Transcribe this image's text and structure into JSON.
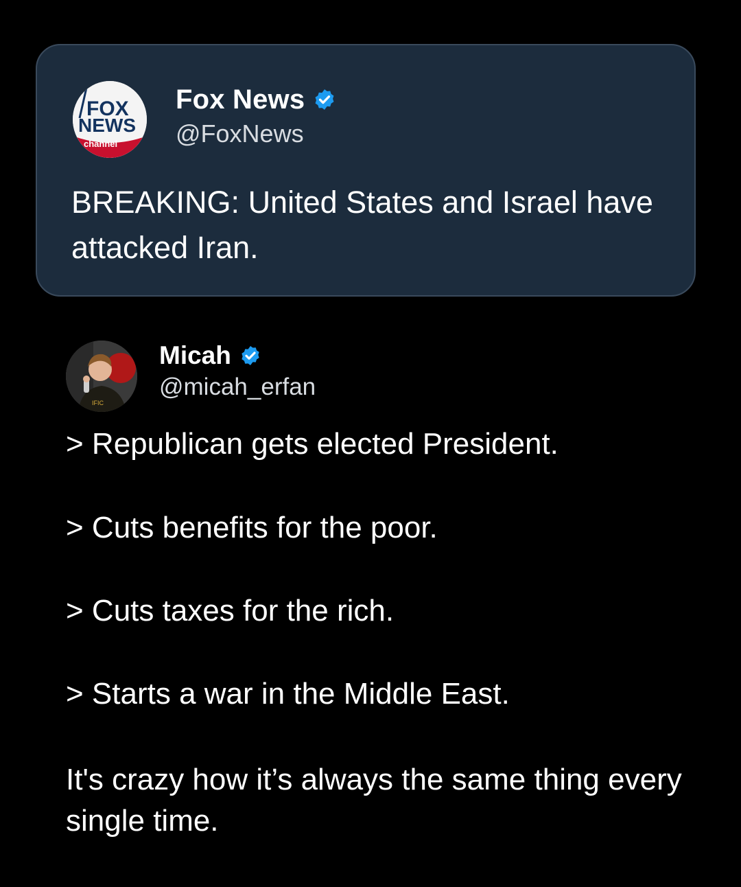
{
  "quoted_tweet": {
    "logo": {
      "icon": "fox-news-channel-logo",
      "line1": "FOX",
      "line2": "NEWS",
      "line3": "channel"
    },
    "author_name": "Fox News",
    "author_handle": "@FoxNews",
    "verified_icon": "verified-badge-icon",
    "text": "BREAKING: United States and Israel have attacked Iran."
  },
  "tweet": {
    "avatar_icon": "user-avatar-photo",
    "author_name": "Micah",
    "author_handle": "@micah_erfan",
    "verified_icon": "verified-badge-icon",
    "lines": [
      "> Republican gets elected President.",
      "> Cuts benefits for the poor.",
      "> Cuts taxes for the rich.",
      "> Starts a war in the Middle East."
    ],
    "closing": "It's crazy how it’s always the same thing every single time."
  },
  "colors": {
    "background": "#000000",
    "card_background": "#1c2c3d",
    "verified_blue": "#1d9bf0",
    "text": "#ffffff",
    "handle_text": "#d9dde2"
  }
}
